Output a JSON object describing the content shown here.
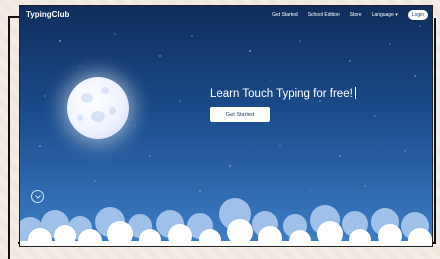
{
  "header": {
    "logo_text": "TypingClub",
    "nav_items": [
      {
        "label": "Get Started"
      },
      {
        "label": "School Edition"
      },
      {
        "label": "Store"
      },
      {
        "label": "Language ▾"
      }
    ],
    "login_label": "Login"
  },
  "hero": {
    "headline": "Learn Touch Typing for free!",
    "cta_label": "Get Started"
  },
  "icons": {
    "scroll_down": "chevron-down-icon"
  },
  "colors": {
    "sky_top": "#0f2d5c",
    "sky_bottom": "#3f7fc7",
    "accent": "#1b3a70"
  }
}
